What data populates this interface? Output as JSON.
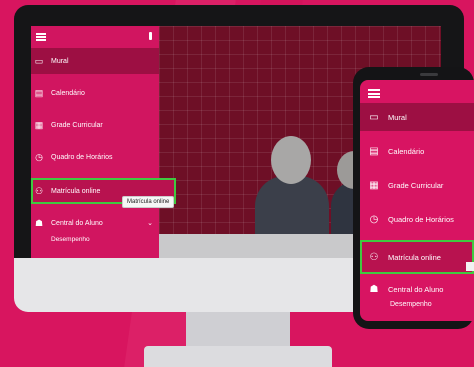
{
  "desktop": {
    "menu": [
      {
        "label": "Mural",
        "icon": "monitor-icon",
        "active": true
      },
      {
        "label": "Calendário",
        "icon": "calendar-icon"
      },
      {
        "label": "Grade Curricular",
        "icon": "grid-icon"
      },
      {
        "label": "Quadro de Horários",
        "icon": "clock-icon"
      },
      {
        "label": "Matrícula online",
        "icon": "user-plus-icon",
        "highlighted": true
      },
      {
        "label": "Central do Aluno",
        "icon": "student-icon"
      }
    ],
    "submenu": [
      "Desempenho"
    ],
    "tooltip": "Matrícula online"
  },
  "phone": {
    "menu": [
      {
        "label": "Mural",
        "icon": "monitor-icon",
        "active": true
      },
      {
        "label": "Calendário",
        "icon": "calendar-icon"
      },
      {
        "label": "Grade Curricular",
        "icon": "grid-icon"
      },
      {
        "label": "Quadro de Horários",
        "icon": "clock-icon"
      },
      {
        "label": "Matrícula online",
        "icon": "user-plus-icon",
        "highlighted": true
      },
      {
        "label": "Central do Aluno",
        "icon": "student-icon"
      }
    ],
    "submenu": [
      "Desempenho"
    ]
  },
  "colors": {
    "brand": "#d81462",
    "active": "#9d0f43",
    "highlight_outline": "#40c940"
  }
}
